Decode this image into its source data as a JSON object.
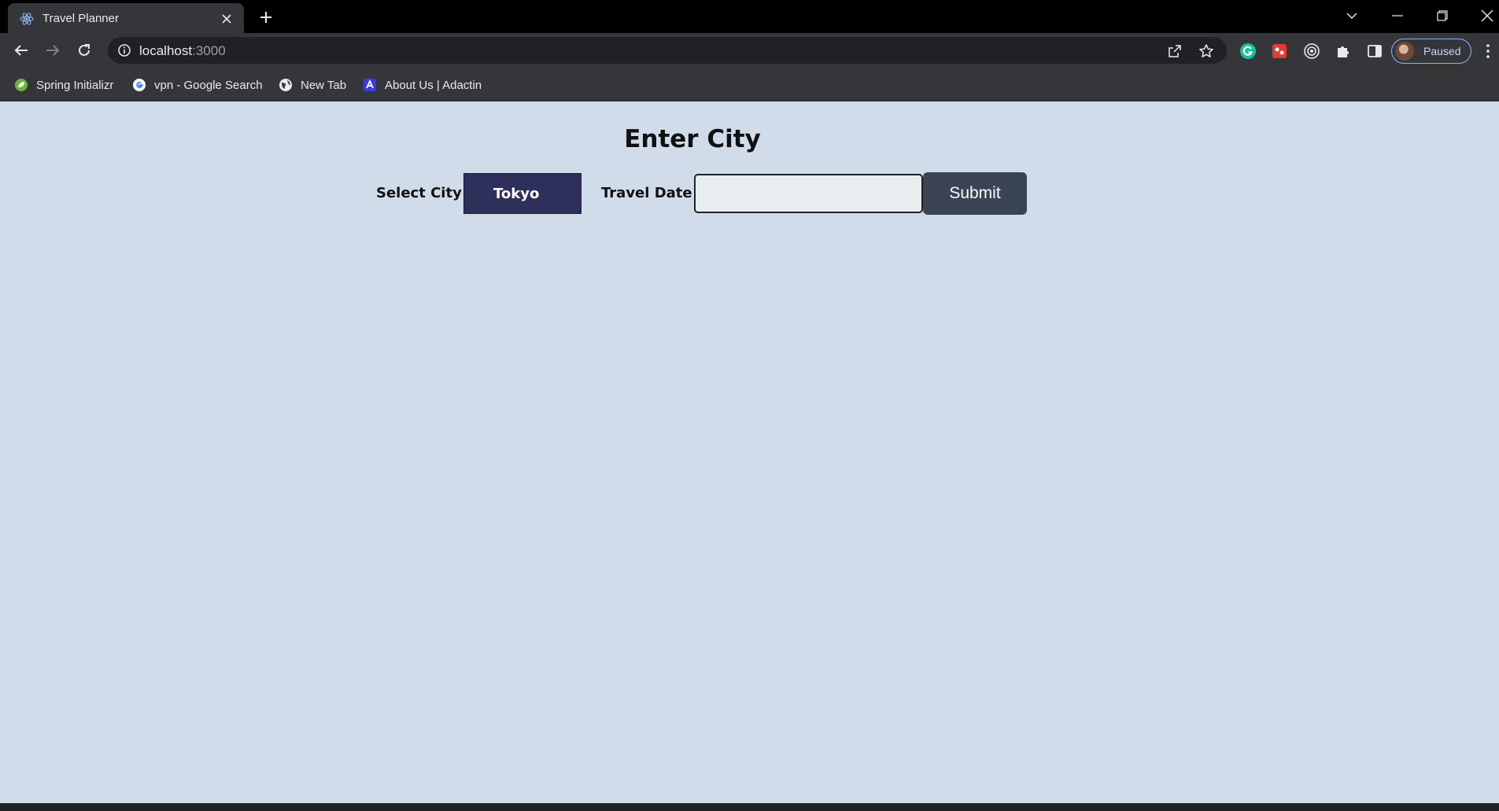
{
  "browser": {
    "tab": {
      "title": "Travel Planner",
      "favicon": "react-icon"
    },
    "address": {
      "host": "localhost",
      "port": ":3000"
    },
    "profile": {
      "label": "Paused"
    },
    "bookmarks": [
      {
        "label": "Spring Initializr",
        "icon": "spring-leaf-icon"
      },
      {
        "label": "vpn - Google Search",
        "icon": "google-icon"
      },
      {
        "label": "New Tab",
        "icon": "globe-icon"
      },
      {
        "label": "About Us | Adactin",
        "icon": "adactin-icon"
      }
    ]
  },
  "page": {
    "title": "Enter City",
    "city_label": "Select City",
    "city_value": "Tokyo",
    "date_label": "Travel Date",
    "date_value": "",
    "submit_label": "Submit"
  },
  "colors": {
    "page_background": "#d1dcea",
    "select_background": "#2f2f5b",
    "submit_background": "#3b4455"
  }
}
